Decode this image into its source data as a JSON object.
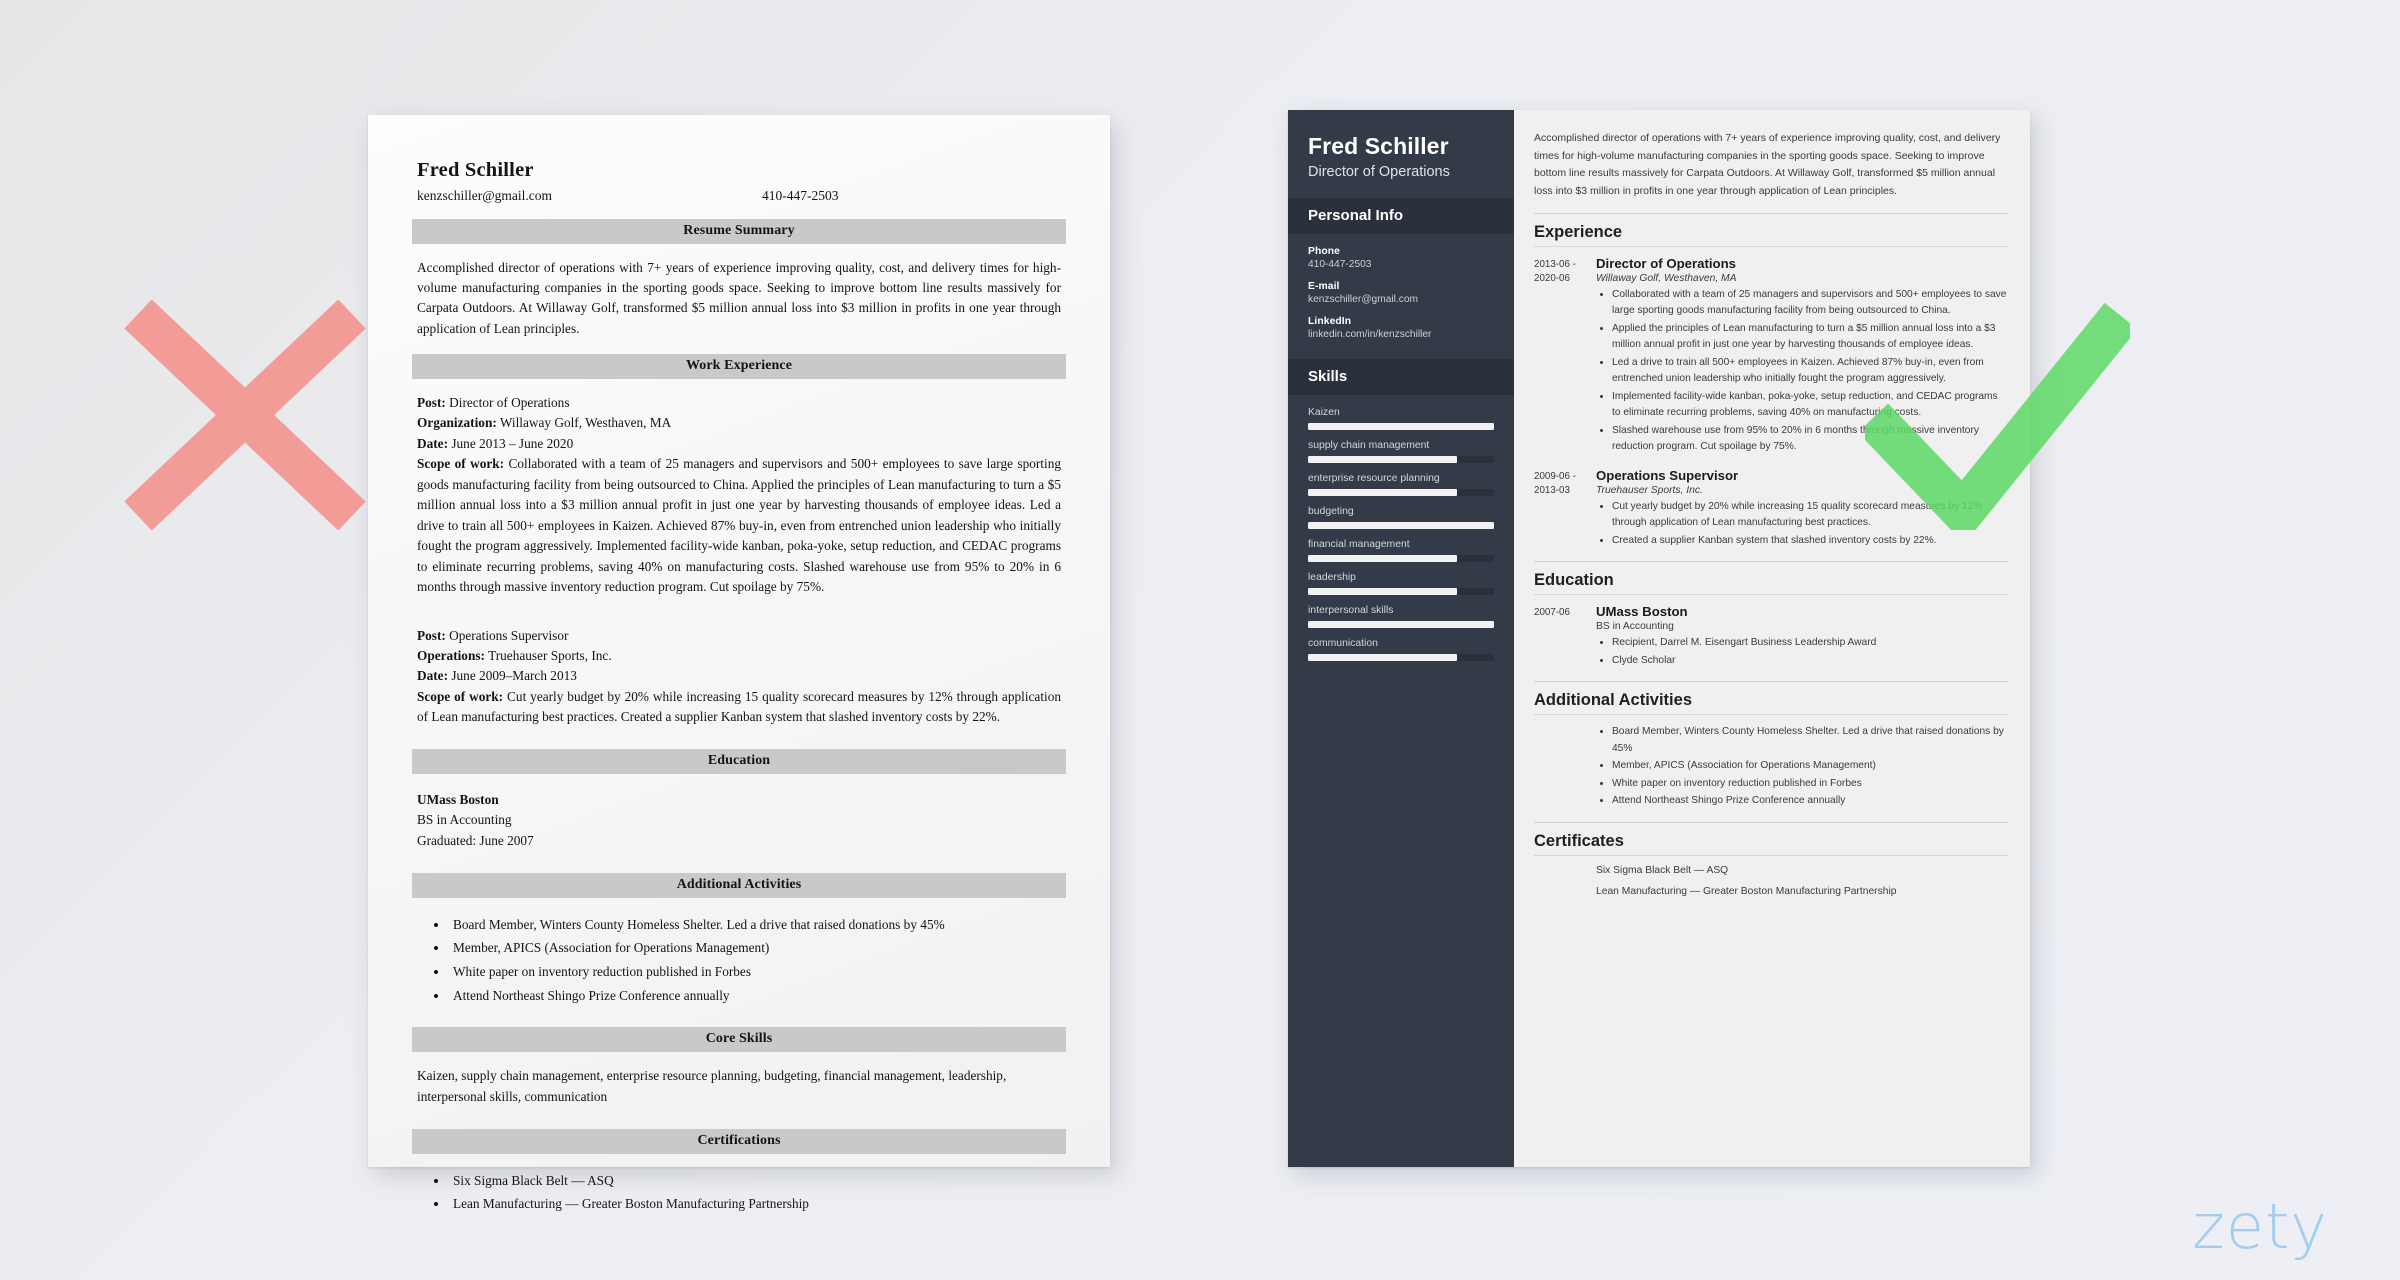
{
  "colors": {
    "page_background": "#eceef3",
    "x_mark": "#f58b85",
    "check_mark": "#5ed966",
    "sidebar_dark": "#343b48",
    "sidebar_header_dark": "#2b313c",
    "section_bar_gray": "#c9c9c9",
    "zety_blue": "#9dcbee"
  },
  "brand": {
    "logo_text": "zety"
  },
  "bad_resume": {
    "name": "Fred Schiller",
    "email": "kenzschiller@gmail.com",
    "phone": "410-447-2503",
    "sections": {
      "summary_heading": "Resume Summary",
      "summary_text": "Accomplished director of operations with 7+ years of experience improving quality, cost, and delivery times for high-volume manufacturing companies in the sporting goods space. Seeking to improve bottom line results massively for Carpata Outdoors. At Willaway Golf, transformed $5 million annual loss into $3 million in profits in one year through application of Lean principles.",
      "work_heading": "Work Experience",
      "education_heading": "Education",
      "activities_heading": "Additional Activities",
      "skills_heading": "Core Skills",
      "certifications_heading": "Certifications"
    },
    "jobs": [
      {
        "post_label": "Post:",
        "post_value": "Director of Operations",
        "org_label": "Organization:",
        "org_value": "Willaway Golf, Westhaven, MA",
        "date_label": "Date:",
        "date_value": "June 2013 – June 2020",
        "scope_label": "Scope of work:",
        "scope_value": "Collaborated with a team of 25 managers and supervisors and 500+ employees to save large sporting goods manufacturing facility from being outsourced to China. Applied the principles of Lean manufacturing to turn a $5 million annual loss into a $3 million annual profit in just one year by harvesting thousands of employee ideas. Led a drive to train all 500+ employees in Kaizen. Achieved 87% buy-in, even from entrenched union leadership who initially fought the program aggressively. Implemented facility-wide kanban, poka-yoke, setup reduction, and CEDAC programs to eliminate recurring problems, saving 40% on manufacturing costs. Slashed warehouse use from 95% to 20% in 6 months through massive inventory reduction program. Cut spoilage by 75%."
      },
      {
        "post_label": "Post:",
        "post_value": "Operations Supervisor",
        "org_label": "Operations:",
        "org_value": "Truehauser Sports, Inc.",
        "date_label": "Date:",
        "date_value": "June 2009–March 2013",
        "scope_label": "Scope of work:",
        "scope_value": "Cut yearly budget by 20% while increasing 15 quality scorecard measures by 12% through application of Lean manufacturing best practices. Created a supplier Kanban system that slashed inventory costs by 22%."
      }
    ],
    "education": {
      "school": "UMass Boston",
      "degree": "BS in Accounting",
      "graduated": "Graduated: June 2007"
    },
    "activities": [
      "Board Member, Winters County Homeless Shelter. Led a drive that raised donations by 45%",
      "Member, APICS (Association for Operations Management)",
      "White paper on inventory reduction published in Forbes",
      "Attend Northeast Shingo Prize Conference annually"
    ],
    "core_skills_text": "Kaizen, supply chain management, enterprise resource planning, budgeting, financial management, leadership, interpersonal skills, communication",
    "certifications": [
      "Six Sigma Black Belt — ASQ",
      "Lean Manufacturing — Greater Boston Manufacturing Partnership"
    ]
  },
  "good_resume": {
    "sidebar": {
      "name": "Fred Schiller",
      "title": "Director of Operations",
      "personal_info_heading": "Personal Info",
      "fields": [
        {
          "label": "Phone",
          "value": "410-447-2503"
        },
        {
          "label": "E-mail",
          "value": "kenzschiller@gmail.com"
        },
        {
          "label": "LinkedIn",
          "value": "linkedin.com/in/kenzschiller"
        }
      ],
      "skills_heading": "Skills",
      "skills": [
        {
          "name": "Kaizen",
          "level": 100
        },
        {
          "name": "supply chain management",
          "level": 80
        },
        {
          "name": "enterprise resource planning",
          "level": 80
        },
        {
          "name": "budgeting",
          "level": 100
        },
        {
          "name": "financial management",
          "level": 80
        },
        {
          "name": "leadership",
          "level": 80
        },
        {
          "name": "interpersonal skills",
          "level": 100
        },
        {
          "name": "communication",
          "level": 80
        }
      ]
    },
    "main": {
      "summary": "Accomplished director of operations with 7+ years of experience improving quality, cost, and delivery times for high-volume manufacturing companies in the sporting goods space. Seeking to improve bottom line results massively for Carpata Outdoors. At Willaway Golf, transformed $5 million annual loss into $3 million in profits in one year through application of Lean principles.",
      "experience_heading": "Experience",
      "experience": [
        {
          "date": "2013-06 - 2020-06",
          "role": "Director of Operations",
          "org": "Willaway Golf, Westhaven, MA",
          "bullets": [
            "Collaborated with a team of 25 managers and supervisors and 500+ employees to save large sporting goods manufacturing facility from being outsourced to China.",
            "Applied the principles of Lean manufacturing to turn a $5 million annual loss into a $3 million annual profit in just one year by harvesting thousands of employee ideas.",
            "Led a drive to train all 500+ employees in Kaizen. Achieved 87% buy-in, even from entrenched union leadership who initially fought the program aggressively.",
            "Implemented facility-wide kanban, poka-yoke, setup reduction, and CEDAC programs to eliminate recurring problems, saving 40% on manufacturing costs.",
            "Slashed warehouse use from 95% to 20% in 6 months through massive inventory reduction program. Cut spoilage by 75%."
          ]
        },
        {
          "date": "2009-06 - 2013-03",
          "role": "Operations Supervisor",
          "org": "Truehauser Sports, Inc.",
          "bullets": [
            "Cut yearly budget by 20% while increasing 15 quality scorecard measures by 12% through application of Lean manufacturing best practices.",
            "Created a supplier Kanban system that slashed inventory costs by 22%."
          ]
        }
      ],
      "education_heading": "Education",
      "education": [
        {
          "date": "2007-06",
          "school": "UMass Boston",
          "degree": "BS in Accounting",
          "bullets": [
            "Recipient, Darrel M. Eisengart Business Leadership Award",
            "Clyde Scholar"
          ]
        }
      ],
      "activities_heading": "Additional Activities",
      "activities": [
        "Board Member, Winters County Homeless Shelter. Led a drive that raised donations by 45%",
        "Member, APICS (Association for Operations Management)",
        "White paper on inventory reduction published in Forbes",
        "Attend Northeast Shingo Prize Conference annually"
      ],
      "certificates_heading": "Certificates",
      "certificates": [
        "Six Sigma Black Belt — ASQ",
        "Lean Manufacturing — Greater Boston Manufacturing Partnership"
      ]
    }
  }
}
